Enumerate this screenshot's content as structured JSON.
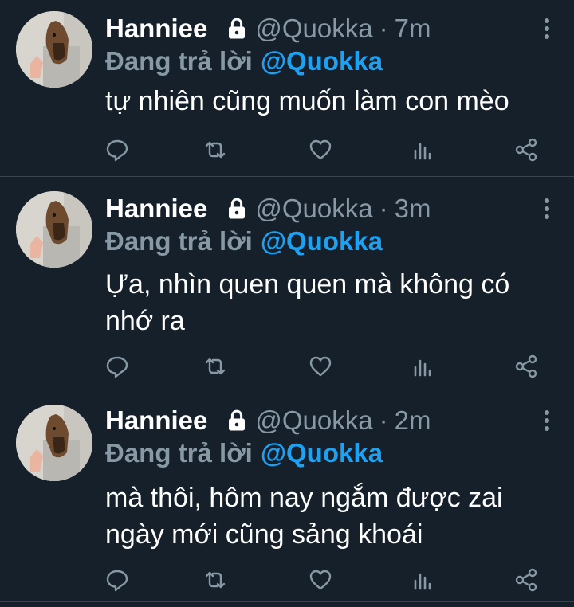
{
  "tweets": [
    {
      "name": "Hanniee",
      "handle": "@Quokka",
      "separator": "·",
      "time": "7m",
      "reply_prefix": "Đang trả lời",
      "reply_to": "@Quokka",
      "text": "tự nhiên cũng muốn làm con mèo"
    },
    {
      "name": "Hanniee",
      "handle": "@Quokka",
      "separator": "·",
      "time": "3m",
      "reply_prefix": "Đang trả lời",
      "reply_to": "@Quokka",
      "text": "Ựa, nhìn quen quen mà không có nhớ ra"
    },
    {
      "name": "Hanniee",
      "handle": "@Quokka",
      "separator": "·",
      "time": "2m",
      "reply_prefix": "Đang trả lời",
      "reply_to": "@Quokka",
      "text": "mà thôi, hôm nay ngắm được zai ngày mới cũng sảng khoái"
    }
  ],
  "icons": {
    "lock": "lock-icon",
    "more": "more-vertical-icon",
    "reply": "reply-icon",
    "retweet": "retweet-icon",
    "like": "heart-icon",
    "analytics": "analytics-icon",
    "share": "share-icon"
  },
  "colors": {
    "background": "#15202b",
    "divider": "#38444d",
    "primary_text": "#ffffff",
    "secondary_text": "#8899a6",
    "accent": "#1da1f2"
  }
}
